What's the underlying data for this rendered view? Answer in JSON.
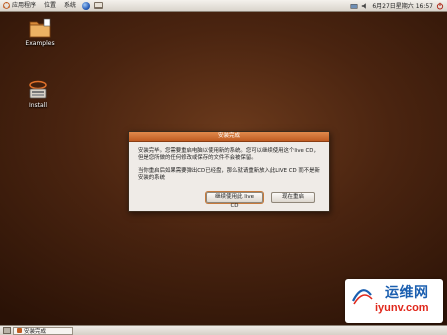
{
  "top_panel": {
    "menus": [
      "应用程序",
      "位置",
      "系统"
    ],
    "clock": "6月27日星期六 16:57"
  },
  "desktop_icons": [
    {
      "label": "Examples"
    },
    {
      "label": "Install"
    }
  ],
  "dialog": {
    "title": "安装完成",
    "paragraph1": "安装完毕。您需要重启电脑以使用新的系统。您可以继续使用这个live CD，但是您所做的任何修改或保存的文件不会被保留。",
    "paragraph2": "当你重启后如果需要弹出CD已经盘，那么就请重新放入此LIVE CD 而不是新安装的系统",
    "btn_continue": "继续使用此 live CD",
    "btn_restart": "现在重启"
  },
  "taskbar": {
    "items": [
      "安装完成"
    ]
  },
  "watermark": {
    "cn_text": "运维网",
    "en_text": "iyunv.com"
  }
}
